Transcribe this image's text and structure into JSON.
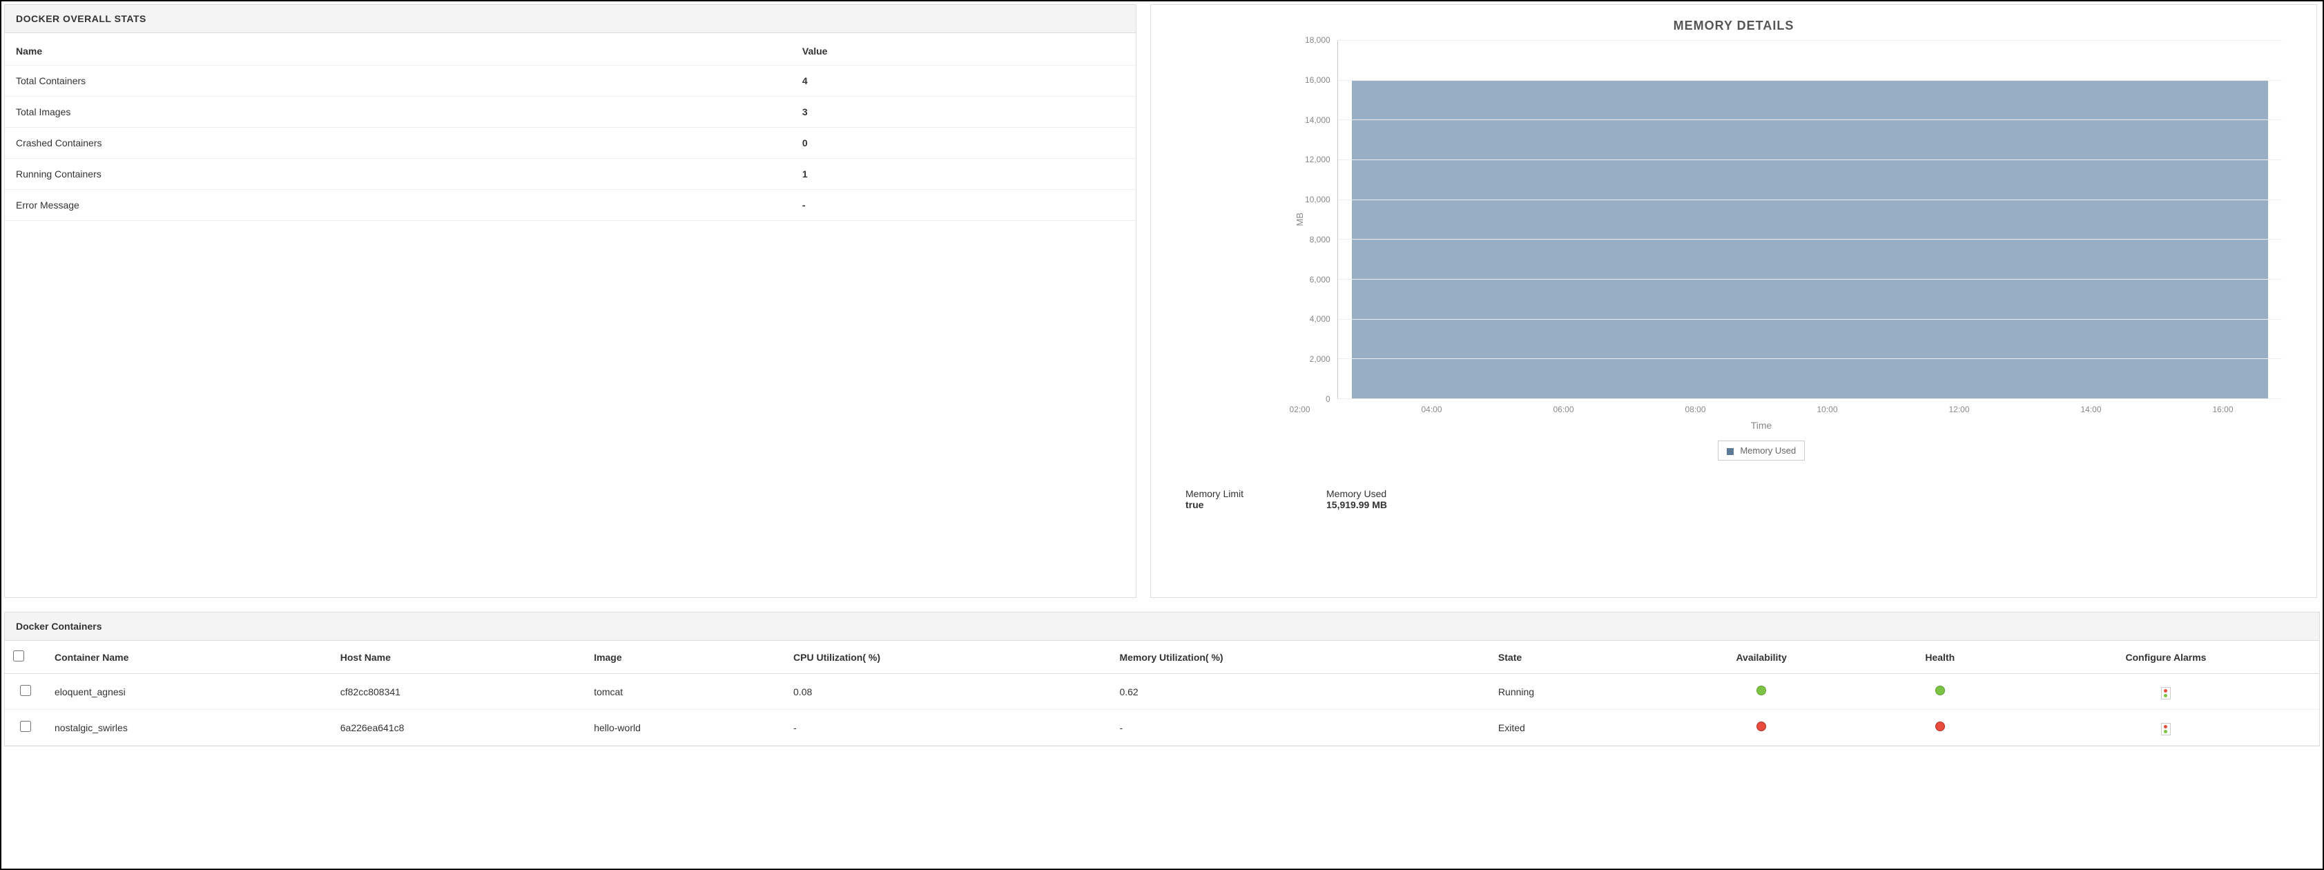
{
  "stats_panel": {
    "title": "DOCKER OVERALL STATS",
    "columns": {
      "name": "Name",
      "value": "Value"
    },
    "rows": [
      {
        "name": "Total Containers",
        "value": "4"
      },
      {
        "name": "Total Images",
        "value": "3"
      },
      {
        "name": "Crashed Containers",
        "value": "0"
      },
      {
        "name": "Running Containers",
        "value": "1"
      },
      {
        "name": "Error Message",
        "value": "-"
      }
    ]
  },
  "chart_panel": {
    "title": "MEMORY DETAILS",
    "y_label": "MB",
    "x_label": "Time",
    "legend_label": "Memory Used",
    "memory_limit_label": "Memory Limit",
    "memory_limit_value": "true",
    "memory_used_label": "Memory Used",
    "memory_used_value": "15,919.99 MB",
    "y_ticks": [
      "18,000",
      "16,000",
      "14,000",
      "12,000",
      "10,000",
      "8,000",
      "6,000",
      "4,000",
      "2,000",
      "0"
    ],
    "x_ticks": [
      "02:00",
      "04:00",
      "06:00",
      "08:00",
      "10:00",
      "12:00",
      "14:00",
      "16:00"
    ]
  },
  "chart_data": {
    "type": "area",
    "title": "MEMORY DETAILS",
    "xlabel": "Time",
    "ylabel": "MB",
    "ylim": [
      0,
      18000
    ],
    "series": [
      {
        "name": "Memory Used",
        "x": [
          "02:00",
          "04:00",
          "06:00",
          "08:00",
          "10:00",
          "12:00",
          "14:00",
          "16:00"
        ],
        "values": [
          15920,
          15920,
          15920,
          15920,
          15920,
          15920,
          15920,
          15920
        ]
      }
    ]
  },
  "containers_panel": {
    "title": "Docker Containers",
    "columns": {
      "container_name": "Container Name",
      "host_name": "Host Name",
      "image": "Image",
      "cpu": "CPU Utilization( %)",
      "memory": "Memory Utilization( %)",
      "state": "State",
      "availability": "Availability",
      "health": "Health",
      "configure_alarms": "Configure Alarms"
    },
    "rows": [
      {
        "container_name": "eloquent_agnesi",
        "host_name": "cf82cc808341",
        "image": "tomcat",
        "cpu": "0.08",
        "memory": "0.62",
        "state": "Running",
        "availability": "green",
        "health": "green"
      },
      {
        "container_name": "nostalgic_swirles",
        "host_name": "6a226ea641c8",
        "image": "hello-world",
        "cpu": "-",
        "memory": "-",
        "state": "Exited",
        "availability": "red",
        "health": "red"
      }
    ]
  }
}
